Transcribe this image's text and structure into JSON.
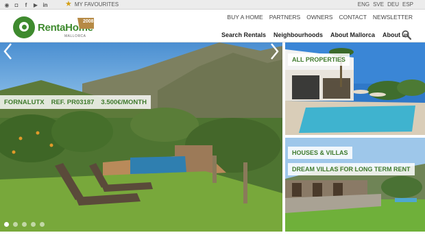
{
  "topbar": {
    "social_icons": [
      "whatsapp-icon",
      "instagram-icon",
      "facebook-icon",
      "youtube-icon",
      "linkedin-icon"
    ],
    "social_glyphs": [
      "◉",
      "◘",
      "f",
      "▶",
      "in"
    ],
    "favourites_label": "MY FAVOURITES",
    "languages": [
      "ENG",
      "SVE",
      "DEU",
      "ESP"
    ]
  },
  "logo": {
    "name": "RentaHome",
    "subtitle": "MALLORCA",
    "year": "2008"
  },
  "nav_top": [
    "BUY A HOME",
    "PARTNERS",
    "OWNERS",
    "CONTACT",
    "NEWSLETTER"
  ],
  "nav_main": [
    "Search Rentals",
    "Neighbourhoods",
    "About Mallorca",
    "About us"
  ],
  "hero": {
    "location": "FORNALUTX",
    "reference": "REF. PR03187",
    "price": "3.500€/MONTH",
    "slide_count": 5,
    "active_slide": 1
  },
  "tiles": {
    "all_properties": "ALL PROPERTIES",
    "houses_villas": "HOUSES & VILLAS",
    "dream_villas": "DREAM VILLAS FOR LONG TERM RENT"
  },
  "colors": {
    "brand_green": "#3e8a2e",
    "label_green": "#3e7a2c",
    "badge_gold": "#b68a45",
    "star": "#d4a017"
  }
}
